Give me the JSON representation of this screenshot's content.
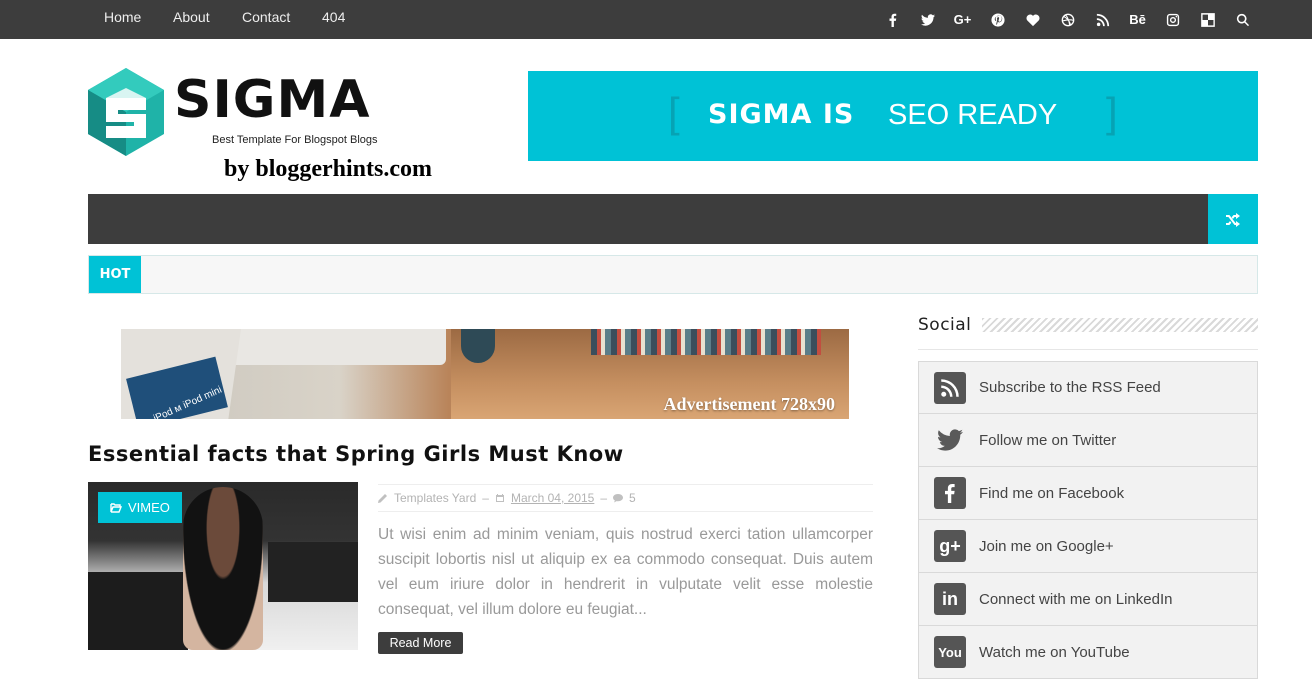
{
  "topnav": {
    "items": [
      "Home",
      "About",
      "Contact",
      "404"
    ],
    "social_icons": [
      "facebook-icon",
      "twitter-icon",
      "google-plus-icon",
      "pinterest-icon",
      "heart-icon",
      "dribbble-icon",
      "rss-icon",
      "behance-icon",
      "instagram-icon",
      "delicious-icon",
      "search-icon"
    ],
    "behance_text": "Bē",
    "gplus_text": "G+"
  },
  "logo": {
    "title": "SIGMA",
    "tagline": "Best Template For Blogspot Blogs",
    "byline": "by bloggerhints.com"
  },
  "banner": {
    "bracket_left": "[",
    "text_bold": "SIGMA IS",
    "text_light": "SEO READY",
    "bracket_right": "]",
    "color": "#00c2d6"
  },
  "ticker": {
    "label": "HOT"
  },
  "ad": {
    "label": "Advertisement 728x90",
    "product_text": "iPod ᴍ iPod mini"
  },
  "post": {
    "title": "Essential facts that Spring Girls Must Know",
    "category": "VIMEO",
    "author": "Templates Yard",
    "date": "March 04, 2015",
    "comments": "5",
    "excerpt": "Ut wisi enim ad minim veniam, quis nostrud exerci tation ullamcorper suscipit lobortis nisl ut aliquip ex ea commodo consequat. Duis autem vel eum iriure dolor in hendrerit in vulputate velit esse molestie consequat, vel illum dolore eu feugiat...",
    "read_more": "Read More"
  },
  "sidebar": {
    "title": "Social",
    "items": [
      {
        "label": "Subscribe to the RSS Feed",
        "icon": "rss-icon"
      },
      {
        "label": "Follow me on Twitter",
        "icon": "twitter-icon"
      },
      {
        "label": "Find me on Facebook",
        "icon": "facebook-icon"
      },
      {
        "label": "Join me on Google+",
        "icon": "google-plus-icon",
        "glyph": "g+"
      },
      {
        "label": "Connect with me on LinkedIn",
        "icon": "linkedin-icon",
        "glyph": "in"
      },
      {
        "label": "Watch me on YouTube",
        "icon": "youtube-icon",
        "glyph": "You"
      }
    ]
  },
  "colors": {
    "accent": "#00c2d6",
    "dark": "#3d3d3d"
  }
}
